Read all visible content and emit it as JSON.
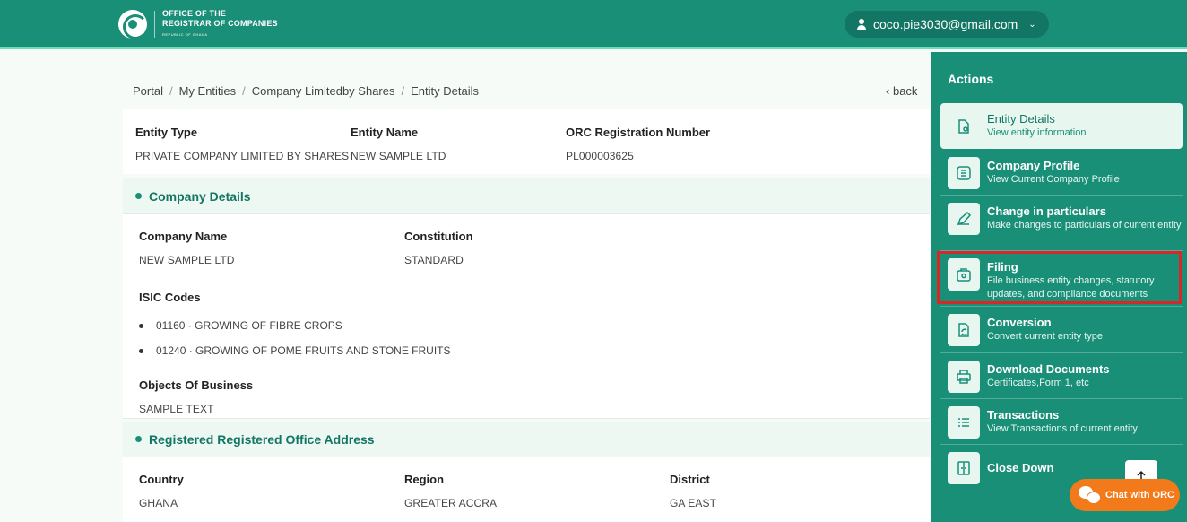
{
  "header": {
    "logo": {
      "line1": "OFFICE OF THE",
      "line2": "REGISTRAR OF COMPANIES",
      "line3": "REPUBLIC OF GHANA"
    },
    "user_email": "coco.pie3030@gmail.com"
  },
  "breadcrumb": [
    "Portal",
    "My Entities",
    "Company Limitedby Shares",
    "Entity Details"
  ],
  "back_label": "back",
  "entity": {
    "type_label": "Entity Type",
    "type_value": "PRIVATE COMPANY LIMITED BY SHARES",
    "name_label": "Entity Name",
    "name_value": "NEW SAMPLE LTD",
    "orc_label": "ORC Registration Number",
    "orc_value": "PL000003625"
  },
  "company_details": {
    "title": "Company Details",
    "company_name_label": "Company Name",
    "company_name_value": "NEW SAMPLE LTD",
    "constitution_label": "Constitution",
    "constitution_value": "STANDARD",
    "isic_label": "ISIC Codes",
    "isic_codes": [
      "01160 · GROWING OF FIBRE CROPS",
      "01240 · GROWING OF POME FRUITS AND STONE FRUITS"
    ],
    "objects_label": "Objects Of Business",
    "objects_value": "SAMPLE TEXT"
  },
  "address": {
    "title": "Registered Registered Office Address",
    "country_label": "Country",
    "country_value": "GHANA",
    "region_label": "Region",
    "region_value": "GREATER ACCRA",
    "district_label": "District",
    "district_value": "GA EAST"
  },
  "actions": {
    "title": "Actions",
    "items": [
      {
        "title": "Entity Details",
        "desc": "View entity information",
        "icon": "document-view-icon"
      },
      {
        "title": "Company Profile",
        "desc": "View Current Company Profile",
        "icon": "list-icon"
      },
      {
        "title": "Change in particulars",
        "desc": "Make changes to particulars of current entity",
        "icon": "pencil-icon"
      },
      {
        "title": "Filing",
        "desc": "File business entity changes, statutory updates, and compliance documents",
        "icon": "briefcase-icon"
      },
      {
        "title": "Conversion",
        "desc": "Convert current entity type",
        "icon": "convert-icon"
      },
      {
        "title": "Download Documents",
        "desc": "Certificates,Form 1, etc",
        "icon": "printer-icon"
      },
      {
        "title": "Transactions",
        "desc": "View Transactions of current entity",
        "icon": "transactions-icon"
      },
      {
        "title": "Close Down",
        "desc": "",
        "icon": "close-down-icon"
      }
    ]
  },
  "chat_label": "Chat with ORC",
  "colors": {
    "primary": "#1a8f78",
    "primary_dark": "#137563",
    "accent_line": "#6fdcb9",
    "highlight": "#d62828",
    "chat": "#f27a1a"
  }
}
